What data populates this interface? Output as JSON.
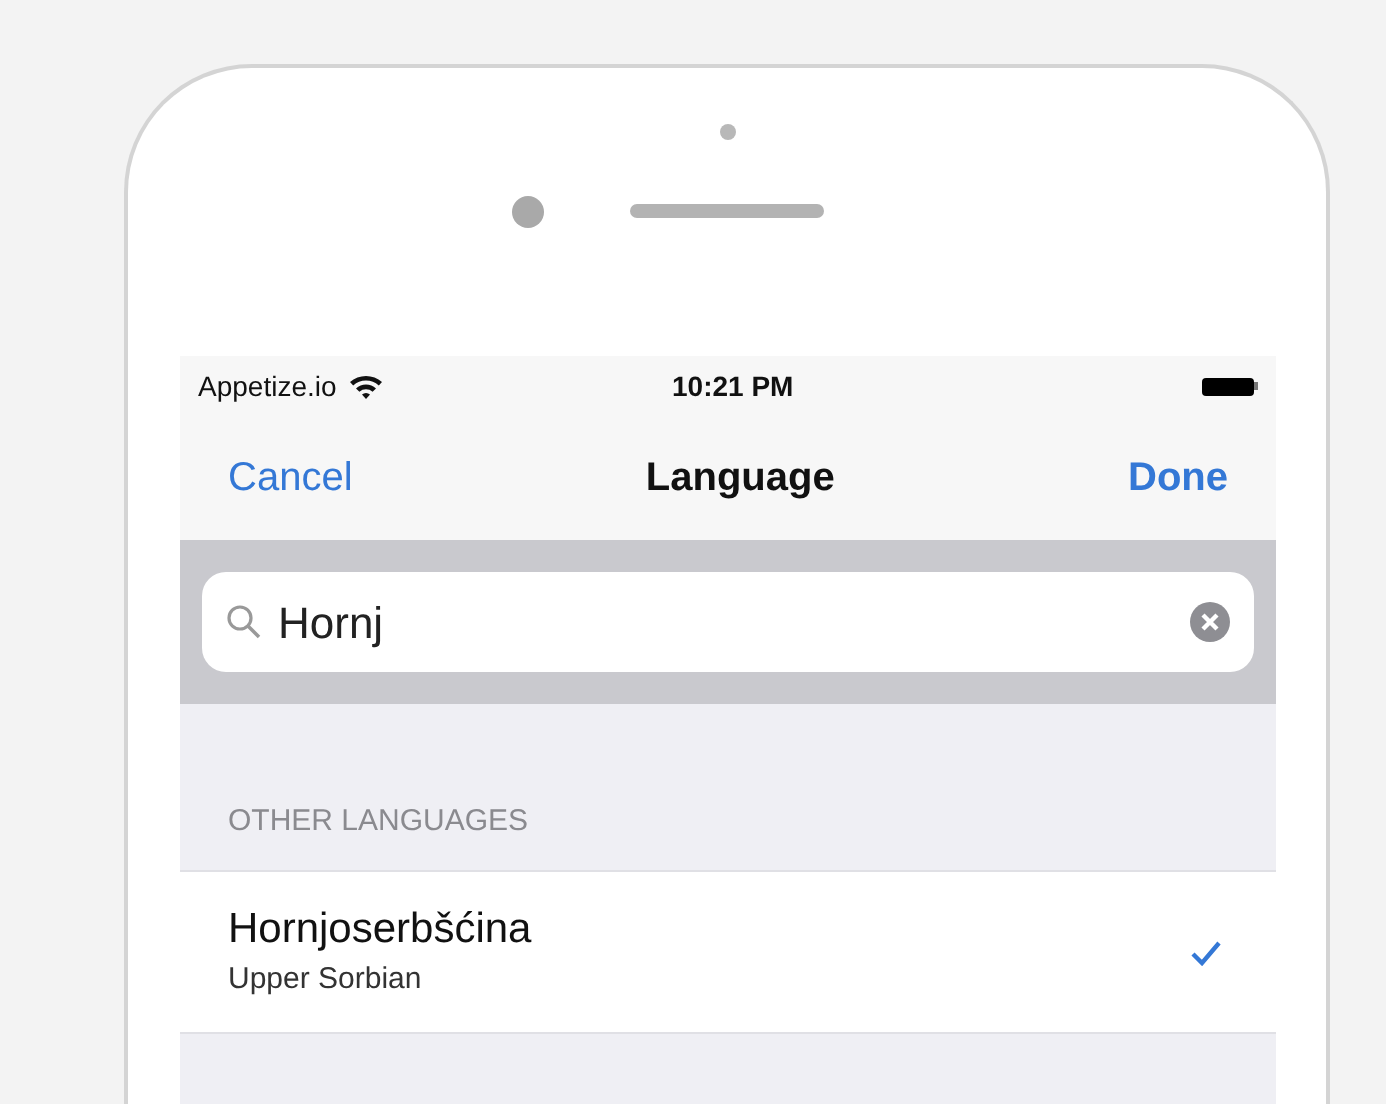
{
  "status_bar": {
    "carrier": "Appetize.io",
    "time": "10:21 PM"
  },
  "nav": {
    "cancel": "Cancel",
    "title": "Language",
    "done": "Done"
  },
  "search": {
    "value": "Hornj"
  },
  "section": {
    "header": "OTHER LANGUAGES",
    "rows": [
      {
        "title": "Hornjoserbšćina",
        "subtitle": "Upper Sorbian",
        "selected": true
      }
    ]
  }
}
